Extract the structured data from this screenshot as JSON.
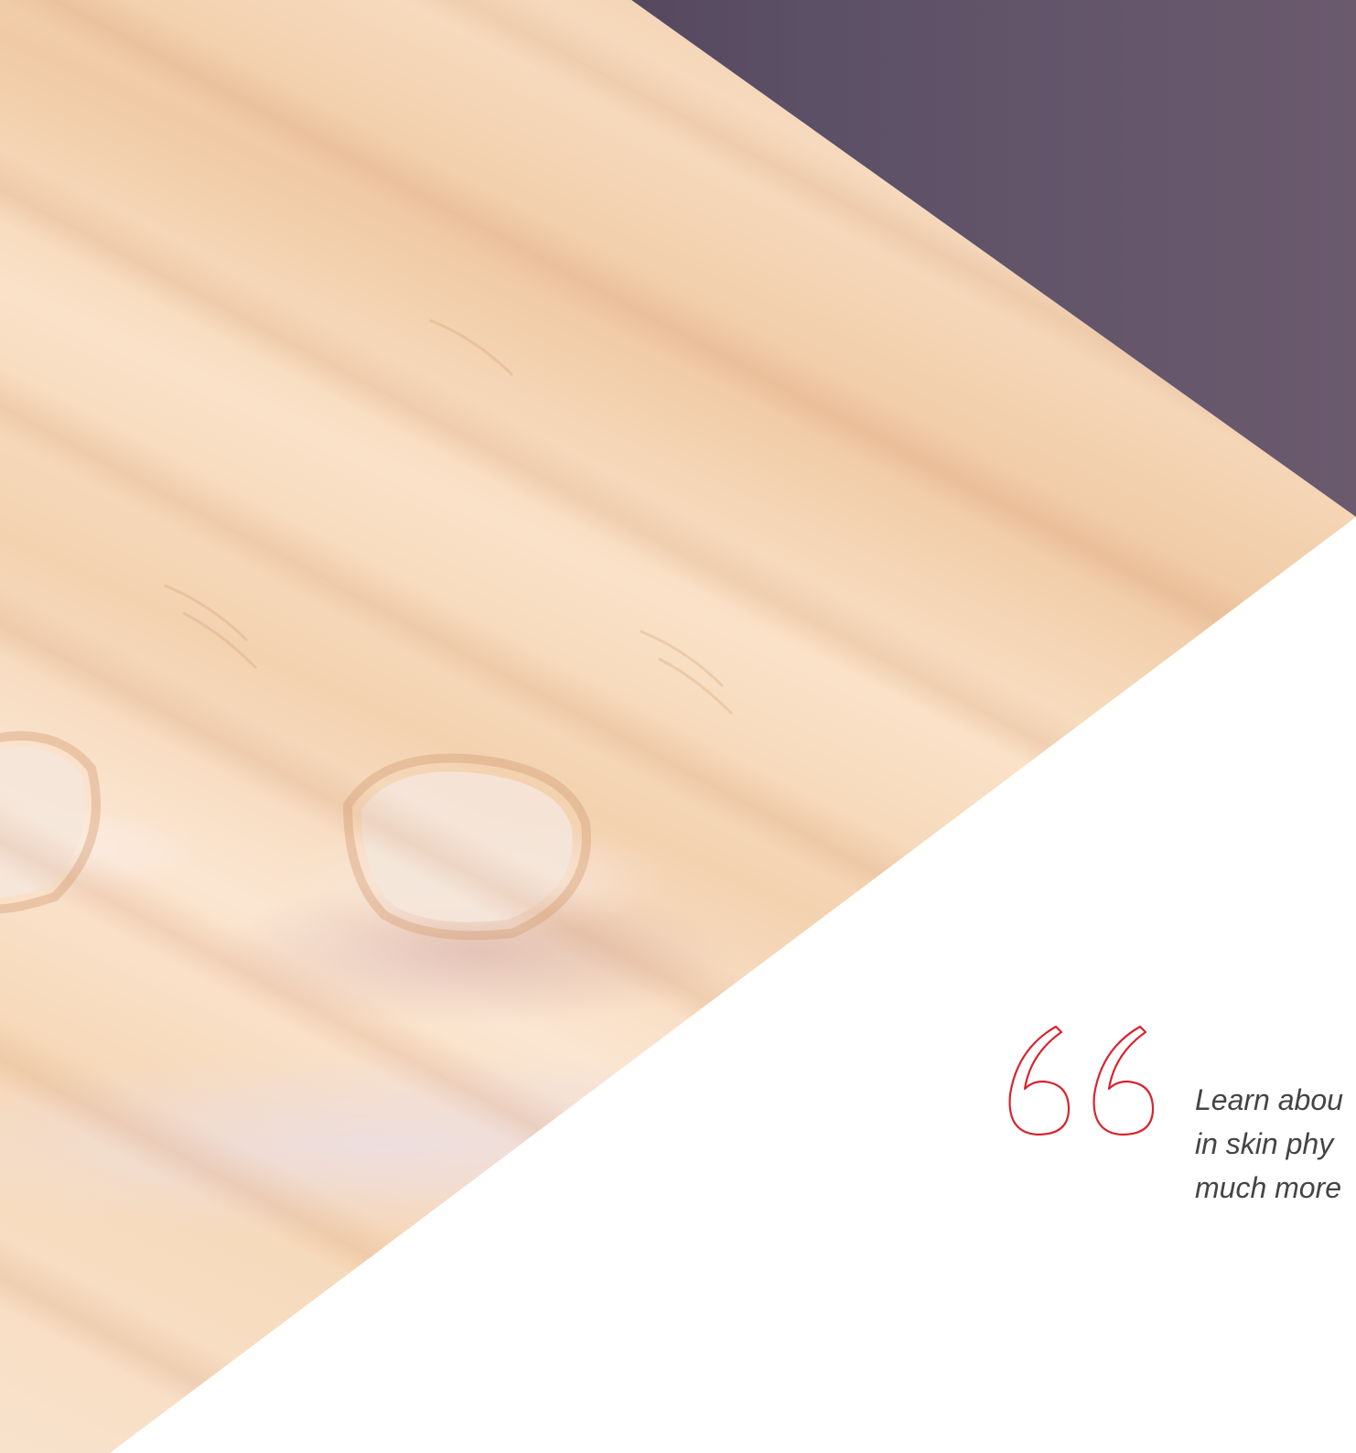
{
  "page": {
    "background": "#ffffff"
  },
  "hero": {
    "image": "hands-fingertips-photo",
    "overlay_color": "#4e3e56"
  },
  "quote": {
    "icon": "quote-open-icon",
    "icon_color": "#d9232e",
    "lines": [
      "Learn abou",
      "in skin phy",
      "much more"
    ],
    "text_color": "#444444"
  }
}
